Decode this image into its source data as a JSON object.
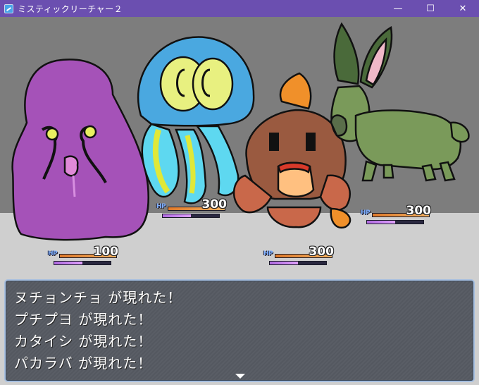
{
  "window": {
    "title": "ミスティックリーチャー２",
    "minimize_glyph": "—",
    "maximize_glyph": "☐",
    "close_glyph": "✕"
  },
  "enemies": [
    {
      "name": "ヌチョンチョ",
      "hp_label": "HP",
      "hp": "100",
      "hp_fraction": 1.0,
      "mp_fraction": 0.5
    },
    {
      "name": "プチプヨ",
      "hp_label": "HP",
      "hp": "300",
      "hp_fraction": 1.0,
      "mp_fraction": 0.5
    },
    {
      "name": "カタイシ",
      "hp_label": "HP",
      "hp": "300",
      "hp_fraction": 1.0,
      "mp_fraction": 0.5
    },
    {
      "name": "パカラバ",
      "hp_label": "HP",
      "hp": "300",
      "hp_fraction": 1.0,
      "mp_fraction": 0.5
    }
  ],
  "messages": [
    "ヌチョンチョ が現れた！",
    "プチプヨ が現れた！",
    "カタイシ が現れた！",
    "パカラバ が現れた！"
  ],
  "colors": {
    "titlebar": "#6b4fb0",
    "hp_gauge": "#e07a2a",
    "mp_gauge": "#b06ae0"
  },
  "icons": {
    "app": "game-app-icon",
    "continue": "continue-arrow-icon"
  }
}
